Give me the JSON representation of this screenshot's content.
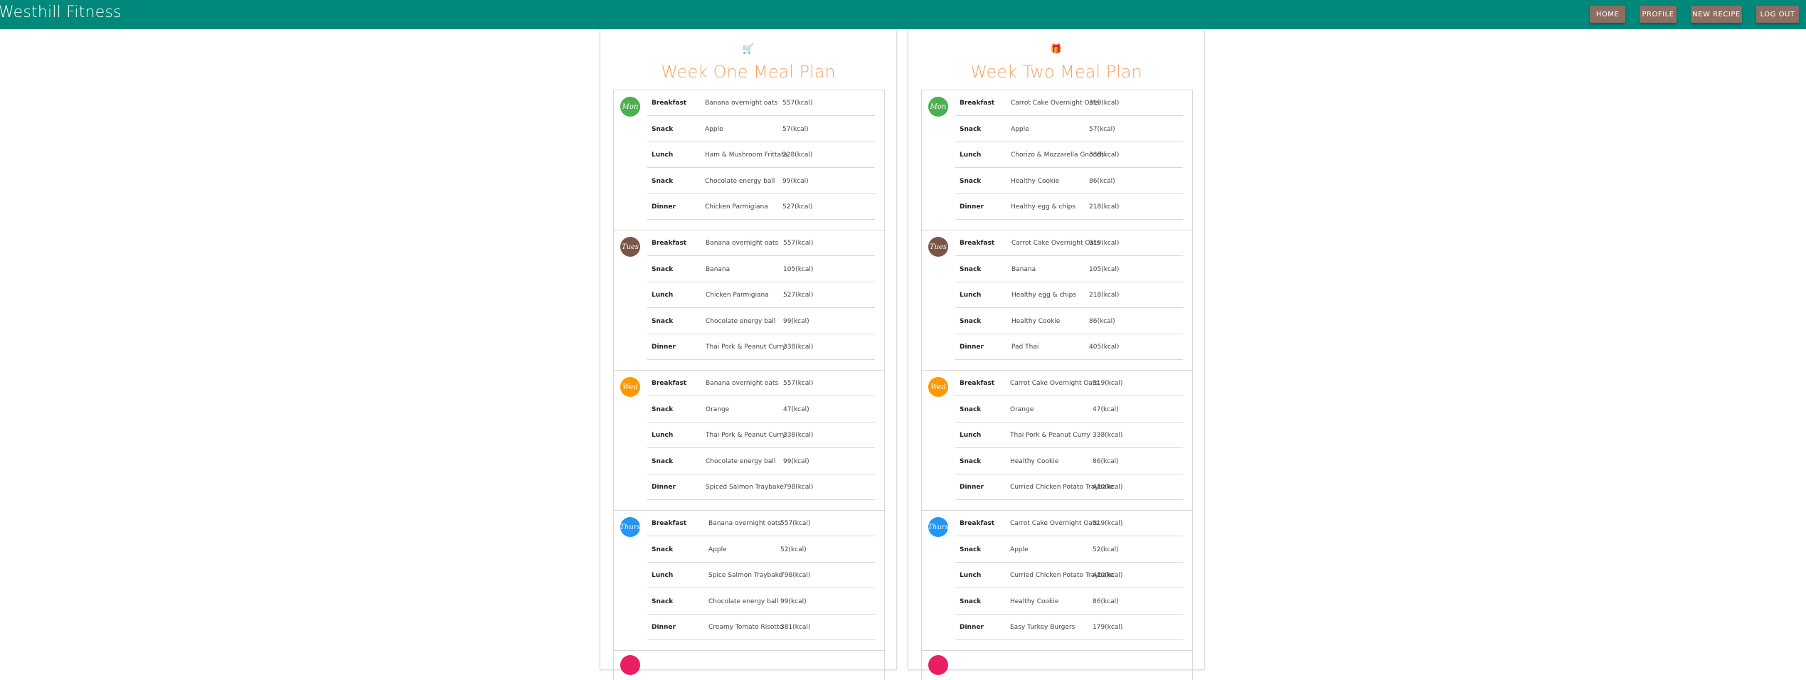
{
  "app": {
    "brand": "Westhill Fitness"
  },
  "nav": [
    {
      "label": "HOME"
    },
    {
      "label": "PROFILE"
    },
    {
      "label": "NEW RECIPE"
    },
    {
      "label": "LOG OUT"
    }
  ],
  "colors": {
    "header": "#00897b",
    "nav_button": "#8d6e63",
    "title": "#f4a460",
    "icon": "#f57c00"
  },
  "plans": [
    {
      "icon": "shopping-cart-icon",
      "title": "Week One Meal Plan",
      "days": [
        {
          "label": "Mon",
          "color": "#4caf50",
          "meals": [
            {
              "type": "Breakfast",
              "food": "Banana overnight oats",
              "cal": "557(kcal)"
            },
            {
              "type": "Snack",
              "food": "Apple",
              "cal": "57(kcal)"
            },
            {
              "type": "Lunch",
              "food": "Ham & Mushroom Frittata",
              "cal": "228(kcal)"
            },
            {
              "type": "Snack",
              "food": "Chocolate energy ball",
              "cal": "99(kcal)"
            },
            {
              "type": "Dinner",
              "food": "Chicken Parmigiana",
              "cal": "527(kcal)"
            }
          ]
        },
        {
          "label": "Tues",
          "color": "#795548",
          "meals": [
            {
              "type": "Breakfast",
              "food": "Banana overnight oats",
              "cal": "557(kcal)"
            },
            {
              "type": "Snack",
              "food": "Banana",
              "cal": "105(kcal)"
            },
            {
              "type": "Lunch",
              "food": "Chicken Parmigiana",
              "cal": "527(kcal)"
            },
            {
              "type": "Snack",
              "food": "Chocolate energy ball",
              "cal": "99(kcal)"
            },
            {
              "type": "Dinner",
              "food": "Thai Pork & Peanut Curry",
              "cal": "338(kcal)"
            }
          ]
        },
        {
          "label": "Wed",
          "color": "#ff9800",
          "meals": [
            {
              "type": "Breakfast",
              "food": "Banana overnight oats",
              "cal": "557(kcal)"
            },
            {
              "type": "Snack",
              "food": "Orange",
              "cal": "47(kcal)"
            },
            {
              "type": "Lunch",
              "food": "Thai Pork & Peanut Curry",
              "cal": "338(kcal)"
            },
            {
              "type": "Snack",
              "food": "Chocolate energy ball",
              "cal": "99(kcal)"
            },
            {
              "type": "Dinner",
              "food": "Spiced Salmon Traybake",
              "cal": "798(kcal)"
            }
          ]
        },
        {
          "label": "Thurs",
          "color": "#2196f3",
          "meals": [
            {
              "type": "Breakfast",
              "food": "Banana overnight oats",
              "cal": "557(kcal)"
            },
            {
              "type": "Snack",
              "food": "Apple",
              "cal": "52(kcal)"
            },
            {
              "type": "Lunch",
              "food": "Spice Salmon Traybake",
              "cal": "798(kcal)"
            },
            {
              "type": "Snack",
              "food": "Chocolate energy ball",
              "cal": "99(kcal)"
            },
            {
              "type": "Dinner",
              "food": "Creamy Tomato Risotto",
              "cal": "381(kcal)"
            }
          ]
        }
      ]
    },
    {
      "icon": "gift-icon",
      "title": "Week Two Meal Plan",
      "days": [
        {
          "label": "Mon",
          "color": "#4caf50",
          "meals": [
            {
              "type": "Breakfast",
              "food": "Carrot Cake Overnight Oats",
              "cal": "319(kcal)"
            },
            {
              "type": "Snack",
              "food": "Apple",
              "cal": "57(kcal)"
            },
            {
              "type": "Lunch",
              "food": "Chorizo & Mozzarella Gnocchi",
              "cal": "338(kcal)"
            },
            {
              "type": "Snack",
              "food": "Healthy Cookie",
              "cal": "86(kcal)"
            },
            {
              "type": "Dinner",
              "food": "Healthy egg & chips",
              "cal": "218(kcal)"
            }
          ]
        },
        {
          "label": "Tues",
          "color": "#795548",
          "meals": [
            {
              "type": "Breakfast",
              "food": "Carrot Cake Overnight Oats",
              "cal": "319(kcal)"
            },
            {
              "type": "Snack",
              "food": "Banana",
              "cal": "105(kcal)"
            },
            {
              "type": "Lunch",
              "food": "Healthy egg & chips",
              "cal": "218(kcal)"
            },
            {
              "type": "Snack",
              "food": "Healthy Cookie",
              "cal": "86(kcal)"
            },
            {
              "type": "Dinner",
              "food": "Pad Thai",
              "cal": "405(kcal)"
            }
          ]
        },
        {
          "label": "Wed",
          "color": "#ff9800",
          "meals": [
            {
              "type": "Breakfast",
              "food": "Carrot Cake Overnight Oats",
              "cal": "319(kcal)"
            },
            {
              "type": "Snack",
              "food": "Orange",
              "cal": "47(kcal)"
            },
            {
              "type": "Lunch",
              "food": "Thai Pork & Peanut Curry",
              "cal": "338(kcal)"
            },
            {
              "type": "Snack",
              "food": "Healthy Cookie",
              "cal": "86(kcal)"
            },
            {
              "type": "Dinner",
              "food": "Curried Chicken Potato Traybake",
              "cal": "410(kcal)"
            }
          ]
        },
        {
          "label": "Thurs",
          "color": "#2196f3",
          "meals": [
            {
              "type": "Breakfast",
              "food": "Carrot Cake Overnight Oats",
              "cal": "319(kcal)"
            },
            {
              "type": "Snack",
              "food": "Apple",
              "cal": "52(kcal)"
            },
            {
              "type": "Lunch",
              "food": "Curried Chicken Potato Traybake",
              "cal": "410(kcal)"
            },
            {
              "type": "Snack",
              "food": "Healthy Cookie",
              "cal": "86(kcal)"
            },
            {
              "type": "Dinner",
              "food": "Easy Turkey Burgers",
              "cal": "179(kcal)"
            }
          ]
        }
      ]
    }
  ]
}
